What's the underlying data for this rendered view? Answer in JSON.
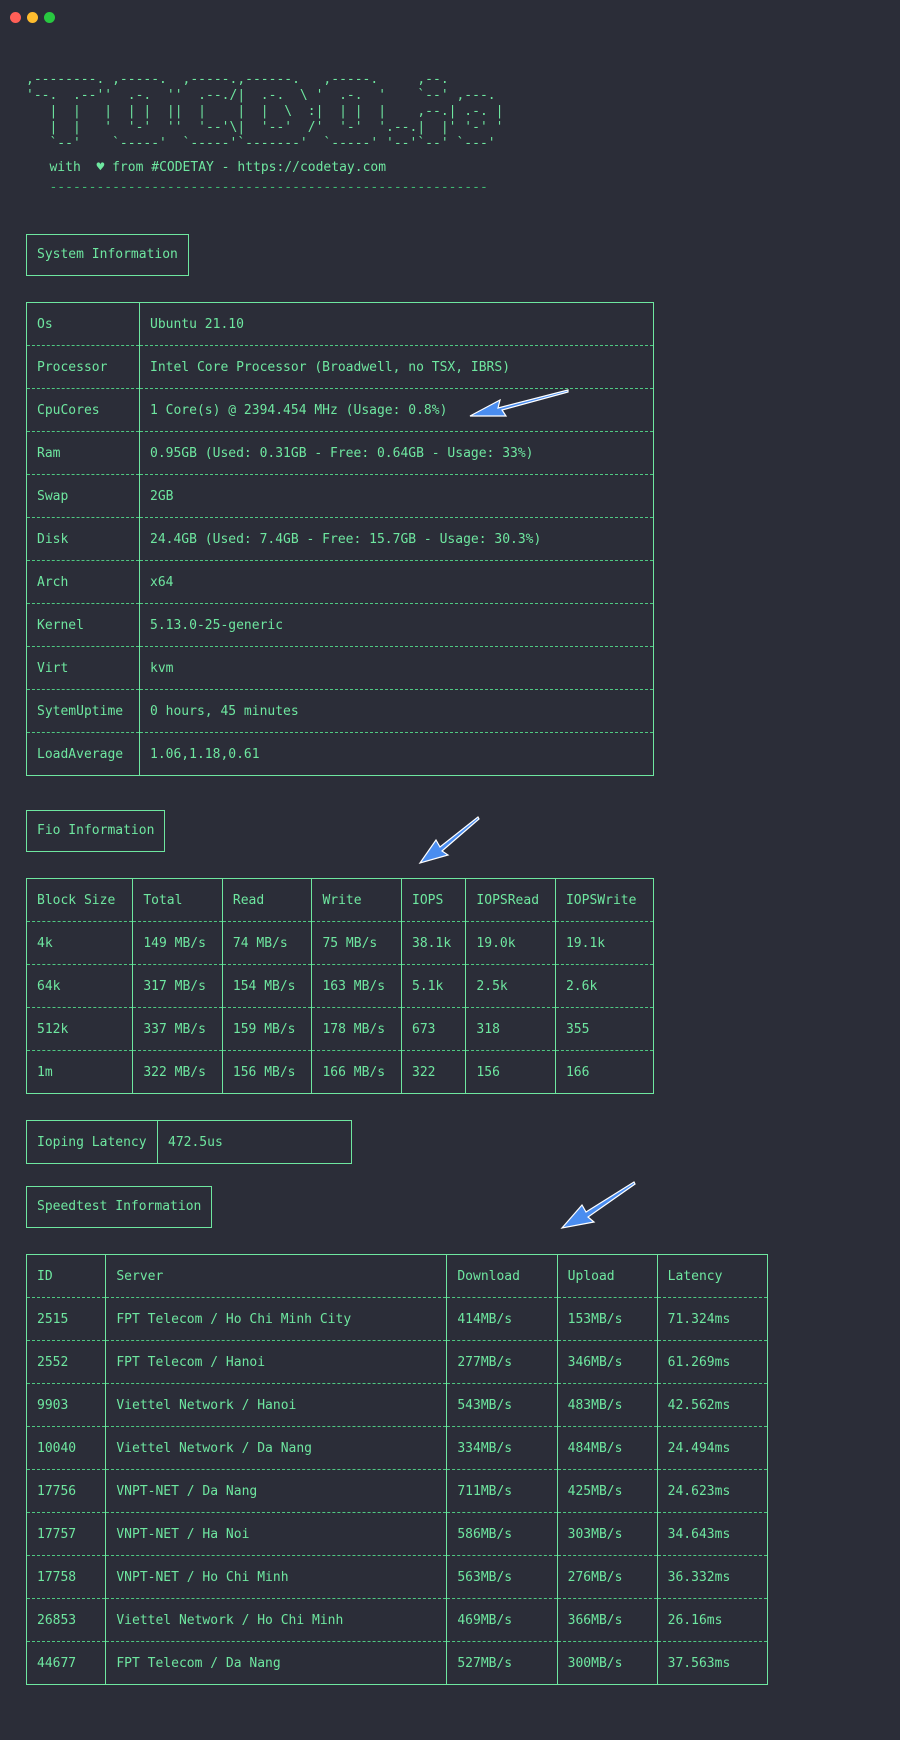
{
  "window": {
    "controls": [
      "close",
      "minimize",
      "maximize"
    ]
  },
  "banner": {
    "ascii": [
      ",--------. ,-----.  ,-----.,------.   ,-----.     ,--.",
      "'--.  .--''  .-.  ''  .--./|  .-.  \\ '  .-.  '    `--' ,---.",
      "   |  |   |  | |  ||  |    |  |  \\  :|  | |  |    ,--.| .-. |",
      "   |  |   '  '-'  ''  '--'\\|  '--'  /'  '-'  '.--.|  |' '-' '",
      "   `--'    `-----'  `-----'`-------'  `-----' '--'`--' `---'"
    ],
    "credit_with": "with",
    "credit_rest": "from #CODETAY - https://codetay.com",
    "separator": "--------------------------------------------------------"
  },
  "system": {
    "title": "System Information",
    "rows": [
      {
        "key": "Os",
        "value": "Ubuntu 21.10"
      },
      {
        "key": "Processor",
        "value": "Intel Core Processor (Broadwell, no TSX, IBRS)"
      },
      {
        "key": "CpuCores",
        "value": "1 Core(s) @ 2394.454 MHz (Usage: 0.8%)"
      },
      {
        "key": "Ram",
        "value": "0.95GB (Used: 0.31GB - Free: 0.64GB - Usage: 33%)"
      },
      {
        "key": "Swap",
        "value": "2GB"
      },
      {
        "key": "Disk",
        "value": "24.4GB (Used: 7.4GB - Free: 15.7GB - Usage: 30.3%)"
      },
      {
        "key": "Arch",
        "value": "x64"
      },
      {
        "key": "Kernel",
        "value": "5.13.0-25-generic"
      },
      {
        "key": "Virt",
        "value": "kvm"
      },
      {
        "key": "SytemUptime",
        "value": "0 hours, 45 minutes"
      },
      {
        "key": "LoadAverage",
        "value": "1.06,1.18,0.61"
      }
    ]
  },
  "fio": {
    "title": "Fio Information",
    "headers": [
      "Block Size",
      "Total",
      "Read",
      "Write",
      "IOPS",
      "IOPSRead",
      "IOPSWrite"
    ],
    "rows": [
      [
        "4k",
        "149 MB/s",
        "74 MB/s",
        "75 MB/s",
        "38.1k",
        "19.0k",
        "19.1k"
      ],
      [
        "64k",
        "317 MB/s",
        "154 MB/s",
        "163 MB/s",
        "5.1k",
        "2.5k",
        "2.6k"
      ],
      [
        "512k",
        "337 MB/s",
        "159 MB/s",
        "178 MB/s",
        "673",
        "318",
        "355"
      ],
      [
        "1m",
        "322 MB/s",
        "156 MB/s",
        "166 MB/s",
        "322",
        "156",
        "166"
      ]
    ]
  },
  "ioping": {
    "label": "Ioping Latency",
    "value": "472.5us"
  },
  "speedtest": {
    "title": "Speedtest Information",
    "headers": [
      "ID",
      "Server",
      "Download",
      "Upload",
      "Latency"
    ],
    "rows": [
      [
        "2515",
        "FPT Telecom / Ho Chi Minh City",
        "414MB/s",
        "153MB/s",
        "71.324ms"
      ],
      [
        "2552",
        "FPT Telecom / Hanoi",
        "277MB/s",
        "346MB/s",
        "61.269ms"
      ],
      [
        "9903",
        "Viettel Network / Hanoi",
        "543MB/s",
        "483MB/s",
        "42.562ms"
      ],
      [
        "10040",
        "Viettel Network / Da Nang",
        "334MB/s",
        "484MB/s",
        "24.494ms"
      ],
      [
        "17756",
        "VNPT-NET / Da Nang",
        "711MB/s",
        "425MB/s",
        "24.623ms"
      ],
      [
        "17757",
        "VNPT-NET / Ha Noi",
        "586MB/s",
        "303MB/s",
        "34.643ms"
      ],
      [
        "17758",
        "VNPT-NET / Ho Chi Minh",
        "563MB/s",
        "276MB/s",
        "36.332ms"
      ],
      [
        "26853",
        "Viettel Network / Ho Chi Minh",
        "469MB/s",
        "366MB/s",
        "26.16ms"
      ],
      [
        "44677",
        "FPT Telecom / Da Nang",
        "527MB/s",
        "300MB/s",
        "37.563ms"
      ]
    ]
  },
  "colors": {
    "background": "#2b2d38",
    "text_green": "#6ee7a0",
    "number_purple": "#b28cf2",
    "arrow_blue": "#4a8df0"
  },
  "icons": [
    "heart-icon",
    "arrow-annotation"
  ]
}
